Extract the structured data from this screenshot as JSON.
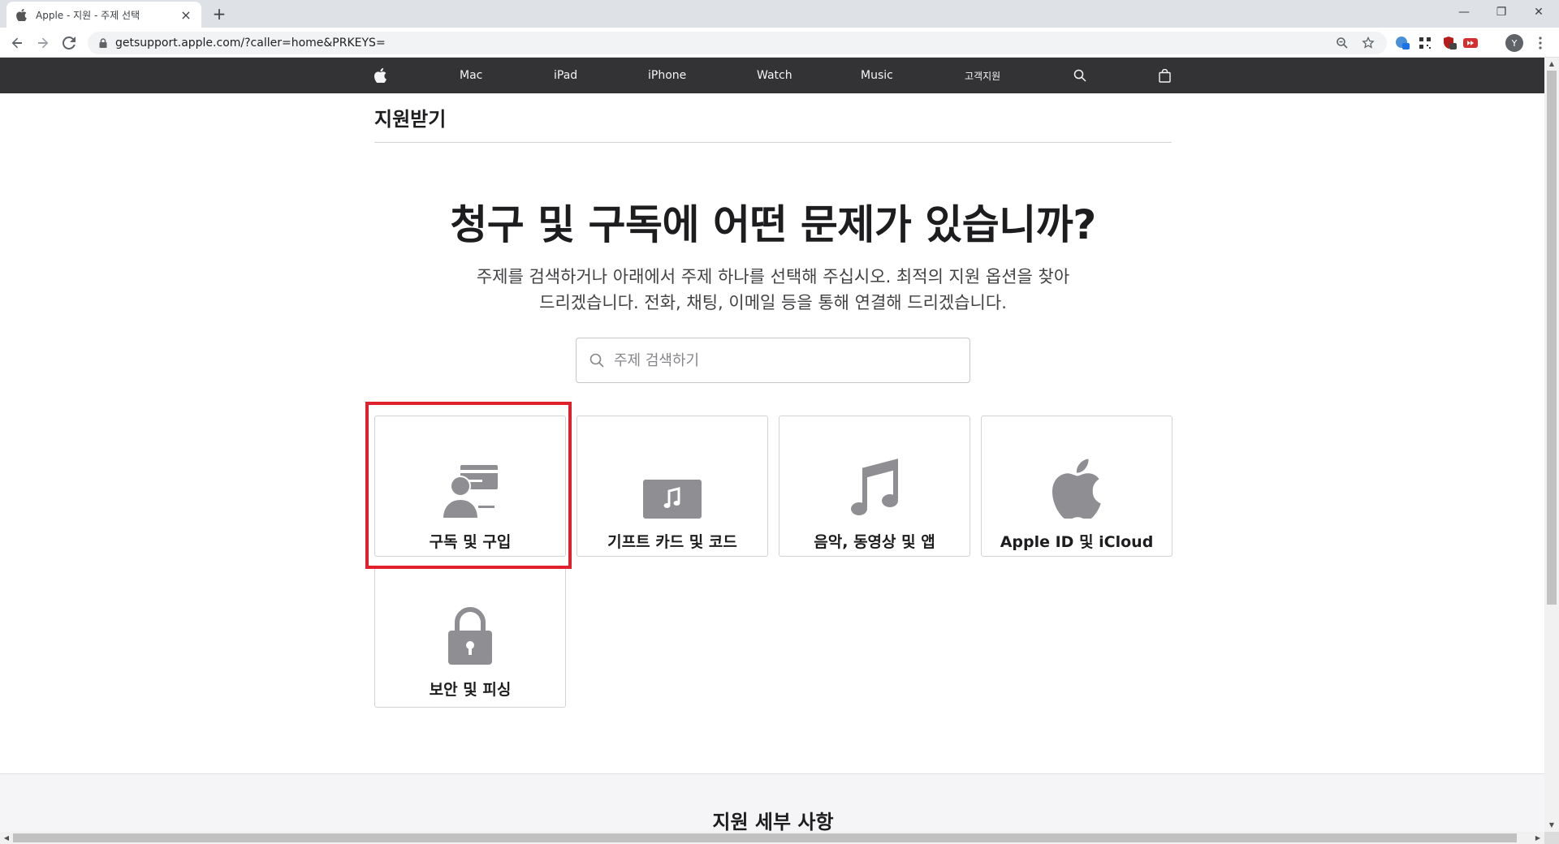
{
  "browser": {
    "tab_title": "Apple - 지원 - 주제 선택",
    "new_tab": "+",
    "url": "getsupport.apple.com/?caller=home&PRKEYS=",
    "avatar_letter": "Y",
    "window": {
      "minimize": "—",
      "restore": "❐",
      "close": "✕"
    }
  },
  "gnav": {
    "items": [
      "Mac",
      "iPad",
      "iPhone",
      "Watch",
      "Music",
      "고객지원"
    ]
  },
  "page": {
    "local_title": "지원받기",
    "headline": "청구 및 구독에 어떤 문제가 있습니까?",
    "intro_line1": "주제를 검색하거나 아래에서 주제 하나를 선택해 주십시오. 최적의 지원 옵션을 찾아",
    "intro_line2": "드리겠습니다. 전화, 채팅, 이메일 등을 통해 연결해 드리겠습니다.",
    "search_placeholder": "주제 검색하기",
    "tiles": [
      {
        "label": "구독 및 구입",
        "icon": "subscription-purchase-icon"
      },
      {
        "label": "기프트 카드 및 코드",
        "icon": "gift-card-music-icon"
      },
      {
        "label": "음악, 동영상 및 앱",
        "icon": "music-note-icon"
      },
      {
        "label": "Apple ID 및 iCloud",
        "icon": "apple-logo-icon"
      },
      {
        "label": "보안 및 피싱",
        "icon": "padlock-icon"
      }
    ],
    "footer_title": "지원 세부 사항"
  },
  "colors": {
    "nav_bg": "#333336",
    "highlight": "#e0202a",
    "icon_gray": "#8e8e93"
  }
}
